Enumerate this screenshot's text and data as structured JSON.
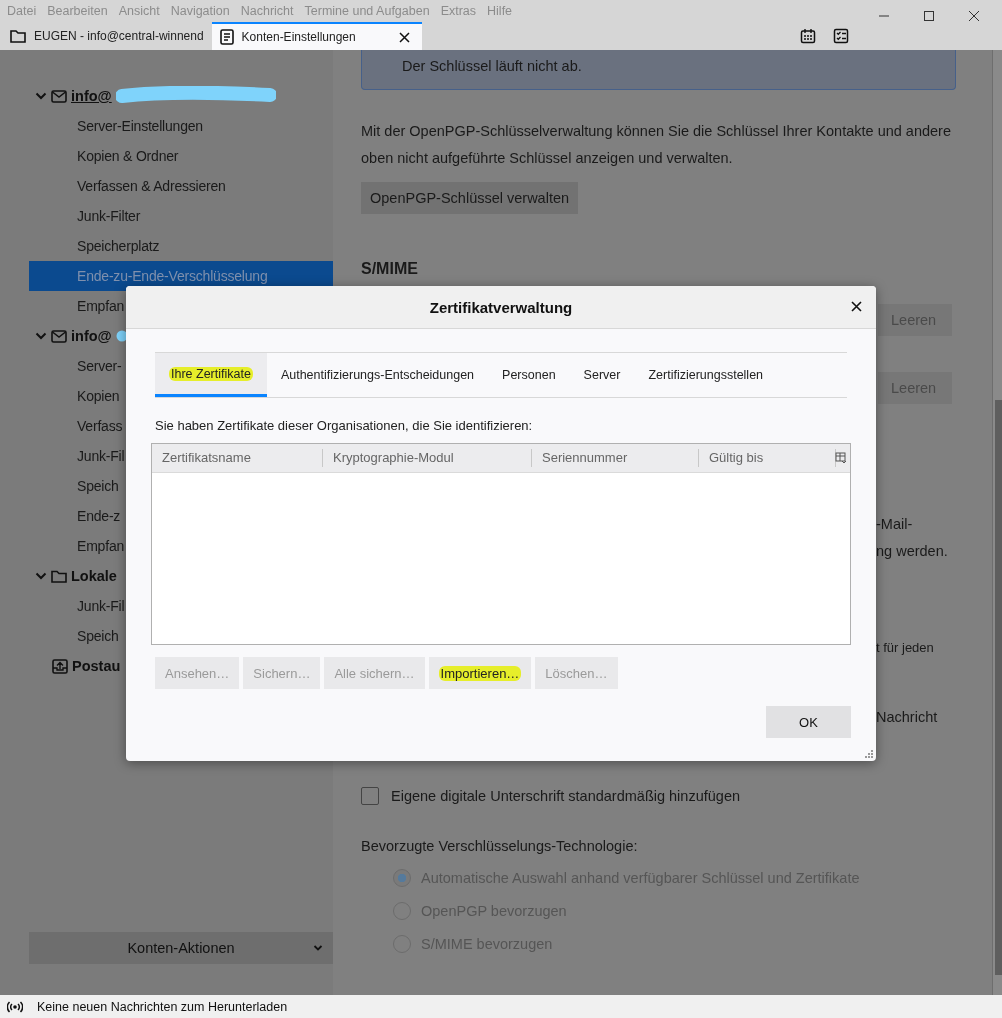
{
  "menu_bar": [
    "Datei",
    "Bearbeiten",
    "Ansicht",
    "Navigation",
    "Nachricht",
    "Termine und Aufgaben",
    "Extras",
    "Hilfe"
  ],
  "tabs": [
    {
      "label": "EUGEN - info@central-winnend",
      "selected": false,
      "kind": "folder"
    },
    {
      "label": "Konten-Einstellungen",
      "selected": true,
      "kind": "page"
    }
  ],
  "sidebar": {
    "accounts": [
      {
        "name": "info@",
        "kind": "mail",
        "redacted": true,
        "expanded": true,
        "children": [
          {
            "label": "Server-Einstellungen",
            "selected": false
          },
          {
            "label": "Kopien & Ordner",
            "selected": false
          },
          {
            "label": "Verfassen & Adressieren",
            "selected": false
          },
          {
            "label": "Junk-Filter",
            "selected": false
          },
          {
            "label": "Speicherplatz",
            "selected": false
          },
          {
            "label": "Ende-zu-Ende-Verschlüsselung",
            "selected": true
          },
          {
            "label": "Empfan",
            "selected": false
          }
        ]
      },
      {
        "name": "info@",
        "kind": "mail",
        "redacted": true,
        "expanded": true,
        "children": [
          {
            "label": "Server-",
            "selected": false
          },
          {
            "label": "Kopien",
            "selected": false
          },
          {
            "label": "Verfass",
            "selected": false
          },
          {
            "label": "Junk-Fil",
            "selected": false
          },
          {
            "label": "Speich",
            "selected": false
          },
          {
            "label": "Ende-z",
            "selected": false
          },
          {
            "label": "Empfan",
            "selected": false
          }
        ]
      },
      {
        "name": "Lokale",
        "kind": "folder",
        "redacted": false,
        "expanded": true,
        "children": [
          {
            "label": "Junk-Fil",
            "selected": false
          },
          {
            "label": "Speich",
            "selected": false
          }
        ]
      }
    ],
    "outbox": "Postau",
    "account_actions": "Konten-Aktionen"
  },
  "settings": {
    "key_notice": "Der Schlüssel läuft nicht ab.",
    "manage_text": "Mit der OpenPGP-Schlüsselverwaltung können Sie die Schlüssel Ihrer Kontakte und andere oben nicht aufgeführte Schlüssel anzeigen und verwalten.",
    "manage_button": "OpenPGP-Schlüssel verwalten",
    "smime_heading": "S/MIME",
    "clear_buttons": [
      "Leeren",
      "Leeren"
    ],
    "partial_lines": [
      "-Mail-",
      "ng werden.",
      "t für jeden",
      "Nachricht"
    ],
    "sign_checkbox": {
      "label": "Eigene digitale Unterschrift standardmäßig hinzufügen",
      "checked": false
    },
    "preferred_label": "Bevorzugte Verschlüsselungs-Technologie:",
    "radios": [
      {
        "label": "Automatische Auswahl anhand verfügbarer Schlüssel und Zertifikate",
        "selected": true
      },
      {
        "label": "OpenPGP bevorzugen",
        "selected": false
      },
      {
        "label": "S/MIME bevorzugen",
        "selected": false
      }
    ]
  },
  "dialog": {
    "title": "Zertifikatverwaltung",
    "tabs": [
      {
        "label": "Ihre Zertifikate",
        "selected": true,
        "highlighted": true
      },
      {
        "label": "Authentifizierungs-Entscheidungen",
        "selected": false,
        "highlighted": false
      },
      {
        "label": "Personen",
        "selected": false,
        "highlighted": false
      },
      {
        "label": "Server",
        "selected": false,
        "highlighted": false
      },
      {
        "label": "Zertifizierungsstellen",
        "selected": false,
        "highlighted": false
      }
    ],
    "description": "Sie haben Zertifikate dieser Organisationen, die Sie identifizieren:",
    "columns": [
      "Zertifikatsname",
      "Kryptographie-Modul",
      "Seriennummer",
      "Gültig bis"
    ],
    "buttons": [
      {
        "label": "Ansehen…",
        "disabled": true,
        "highlighted": false
      },
      {
        "label": "Sichern…",
        "disabled": true,
        "highlighted": false
      },
      {
        "label": "Alle sichern…",
        "disabled": true,
        "highlighted": false
      },
      {
        "label": "Importieren…",
        "disabled": false,
        "highlighted": true
      },
      {
        "label": "Löschen…",
        "disabled": true,
        "highlighted": false
      }
    ],
    "ok": "OK"
  },
  "status_bar": "Keine neuen Nachrichten zum Herunterladen"
}
